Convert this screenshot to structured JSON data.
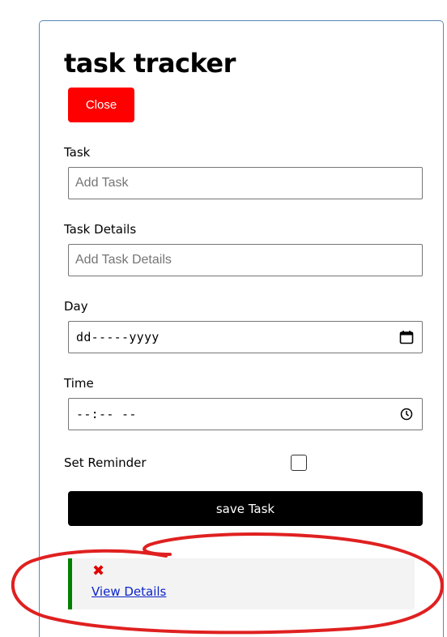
{
  "app": {
    "title": "task tracker",
    "close_label": "Close"
  },
  "form": {
    "task": {
      "label": "Task",
      "placeholder": "Add Task"
    },
    "details": {
      "label": "Task Details",
      "placeholder": "Add Task Details"
    },
    "day": {
      "label": "Day",
      "value": "dd-----yyyy",
      "icon": "calendar-icon"
    },
    "time": {
      "label": "Time",
      "value": "--:-- --",
      "icon": "clock-icon"
    },
    "reminder": {
      "label": "Set Reminder",
      "checked": false
    },
    "save_label": "save Task"
  },
  "task_item": {
    "delete_icon": "✖",
    "link_label": "View Details",
    "border_color": "#008000"
  },
  "colors": {
    "close_button": "#ff0000",
    "save_button": "#000000",
    "annotation": "#e02020",
    "container_border": "#5b88b5"
  }
}
